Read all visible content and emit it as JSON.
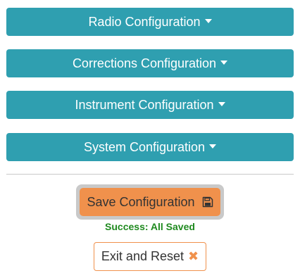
{
  "sections": {
    "radio": {
      "label": "Radio Configuration"
    },
    "corrections": {
      "label": "Corrections Configuration"
    },
    "instrument": {
      "label": "Instrument Configuration"
    },
    "system": {
      "label": "System Configuration"
    }
  },
  "actions": {
    "save_label": "Save Configuration",
    "save_icon": "floppy-disk-icon",
    "status_message": "Success: All Saved",
    "exit_label": "Exit and Reset",
    "exit_icon": "close-icon"
  },
  "colors": {
    "section_bg": "#2f9fb0",
    "accent": "#f0914c",
    "success": "#1f8a1f"
  }
}
